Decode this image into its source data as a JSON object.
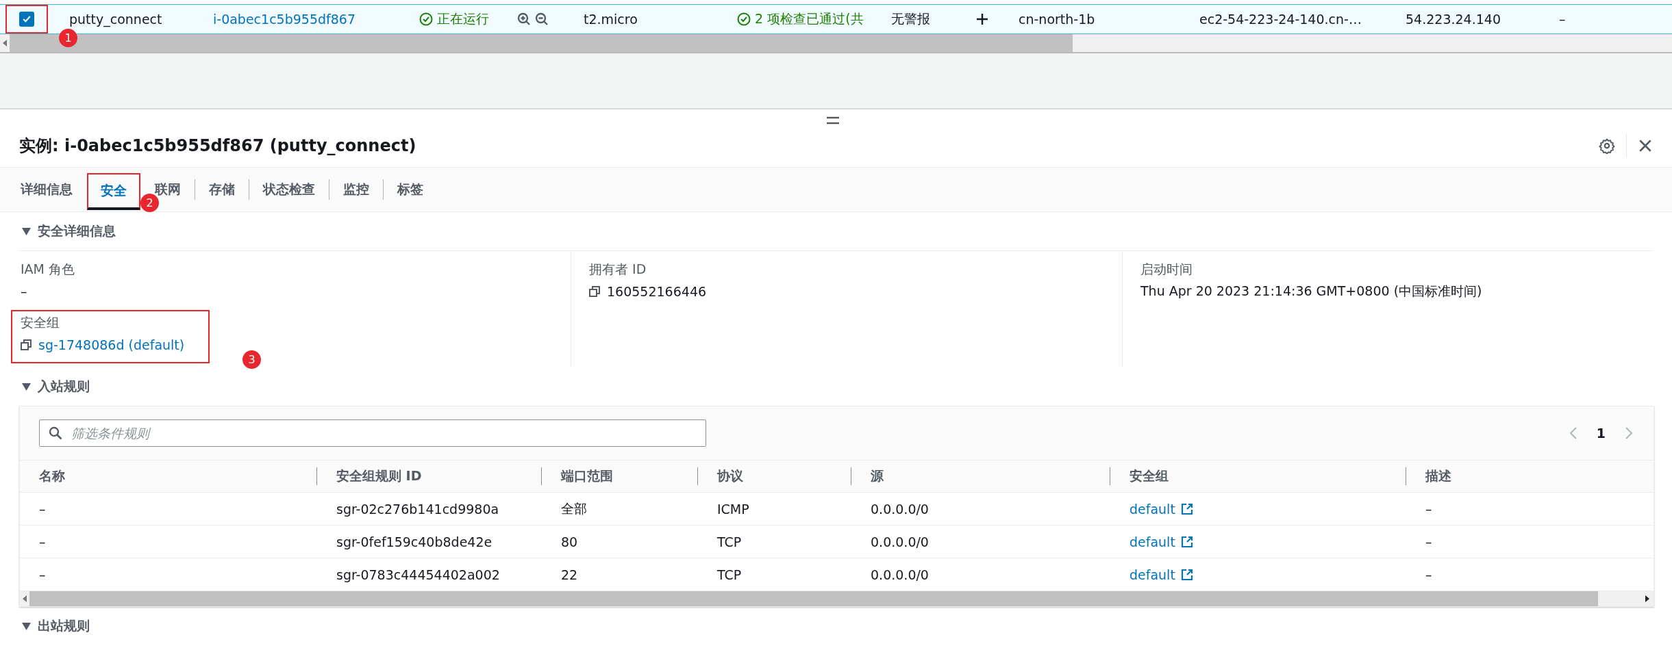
{
  "instance_row": {
    "selected": true,
    "highlighted": true,
    "marker": "1",
    "cells": [
      {
        "kind": "text",
        "text": "putty_connect"
      },
      {
        "kind": "link",
        "text": "i-0abec1c5b955df867"
      },
      {
        "kind": "status",
        "text": "正在运行"
      },
      {
        "kind": "zoom"
      },
      {
        "kind": "text",
        "text": "t2.micro"
      },
      {
        "kind": "status",
        "text": "2 项检查已通过(共"
      },
      {
        "kind": "text",
        "text": "无警报"
      },
      {
        "kind": "add"
      },
      {
        "kind": "text",
        "text": "cn-north-1b"
      },
      {
        "kind": "text",
        "text": "ec2-54-223-24-140.cn-…"
      },
      {
        "kind": "text",
        "text": "54.223.24.140"
      },
      {
        "kind": "text",
        "text": "–"
      }
    ]
  },
  "detail_panel": {
    "title": "实例: i-0abec1c5b955df867 (putty_connect)",
    "tabs": [
      {
        "label": "详细信息",
        "selected": false,
        "highlighted": false
      },
      {
        "label": "安全",
        "selected": true,
        "highlighted": true,
        "marker": "2"
      },
      {
        "label": "联网",
        "selected": false,
        "highlighted": false
      },
      {
        "label": "存储",
        "selected": false,
        "highlighted": false
      },
      {
        "label": "状态检查",
        "selected": false,
        "highlighted": false
      },
      {
        "label": "监控",
        "selected": false,
        "highlighted": false
      },
      {
        "label": "标签",
        "selected": false,
        "highlighted": false
      }
    ],
    "security_details": {
      "title": "安全详细信息",
      "expanded": true,
      "columns": [
        [
          {
            "label": "IAM 角色",
            "kind": "text",
            "value": "–",
            "highlighted": false
          },
          {
            "label": "安全组",
            "kind": "copy-link",
            "value": "sg-1748086d (default)",
            "highlighted": true,
            "marker": "3"
          }
        ],
        [
          {
            "label": "拥有者 ID",
            "kind": "copy",
            "value": "160552166446",
            "highlighted": false
          }
        ],
        [
          {
            "label": "启动时间",
            "kind": "text",
            "value": "Thu Apr 20 2023 21:14:36 GMT+0800 (中国标准时间)",
            "highlighted": false
          }
        ]
      ]
    },
    "inbound_rules": {
      "title": "入站规则",
      "expanded": true,
      "filter": {
        "placeholder": "筛选条件规则"
      },
      "page": "1",
      "columns": [
        "名称",
        "安全组规则 ID",
        "端口范围",
        "协议",
        "源",
        "安全组",
        "描述"
      ],
      "rows": [
        [
          "–",
          "sgr-02c276b141cd9980a",
          "全部",
          "ICMP",
          "0.0.0.0/0",
          "default",
          "–"
        ],
        [
          "–",
          "sgr-0fef159c40b8de42e",
          "80",
          "TCP",
          "0.0.0.0/0",
          "default",
          "–"
        ],
        [
          "–",
          "sgr-0783c44454402a002",
          "22",
          "TCP",
          "0.0.0.0/0",
          "default",
          "–"
        ]
      ]
    },
    "outbound_rules": {
      "title": "出站规则",
      "expanded": true
    }
  }
}
